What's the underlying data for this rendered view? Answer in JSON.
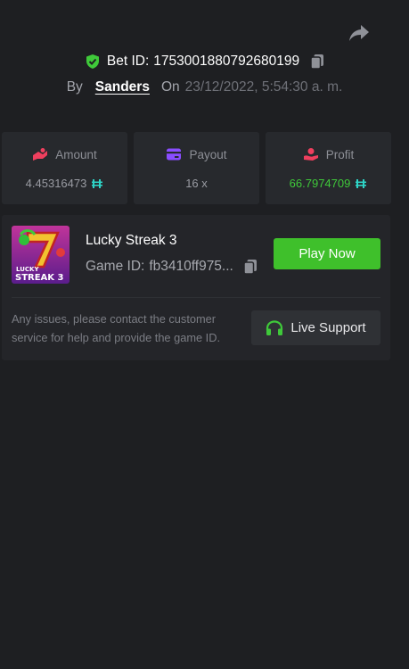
{
  "header": {
    "share_icon": "share-arrow-icon",
    "bet_id_label": "Bet ID:",
    "bet_id": "1753001880792680199",
    "by_label": "By",
    "username": "Sanders",
    "on_label": "On",
    "date": "23/12/2022, 5:54:30 a. m."
  },
  "stats": [
    {
      "label": "Amount",
      "value": "4.45316473",
      "icon": "amount-icon",
      "currency_icon": "hbar-coin-icon"
    },
    {
      "label": "Payout",
      "value": "16 x",
      "icon": "card-icon"
    },
    {
      "label": "Profit",
      "value": "66.7974709",
      "icon": "profit-icon",
      "currency_icon": "hbar-coin-icon"
    }
  ],
  "game": {
    "name": "Lucky Streak 3",
    "id_label": "Game ID:",
    "id": "fb3410ff975...",
    "thumb_line1": "LUCKY",
    "thumb_line2": "STREAK 3",
    "play_label": "Play Now"
  },
  "support": {
    "text": "Any issues, please contact the customer service for help and provide the game ID.",
    "button_label": "Live Support"
  },
  "colors": {
    "background": "#1e1f22",
    "card": "#27292d",
    "accent_green": "#3fc02b",
    "profit_green": "#3fc93a",
    "amount_icon": "#ef3f5e",
    "payout_icon": "#8a4dff",
    "profit_icon": "#ef3f5e",
    "coin": "#2ed4c6"
  }
}
